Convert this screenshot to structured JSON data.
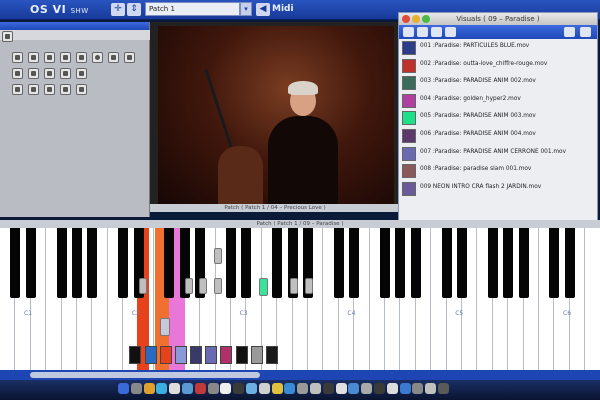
{
  "app": {
    "brand": "OS VI",
    "brand_suffix": "SHW"
  },
  "toolbar": {
    "patch_value": "Patch 1",
    "midi_label": "Midi"
  },
  "visuals_window": {
    "title": "Visuals ( 09 – Paradise )",
    "items": [
      {
        "label": "001 :Paradise: PARTICULES BLUE.mov",
        "thumb_color": "#2a3c8a"
      },
      {
        "label": "002 :Paradise: outta-love_chiffre-rouge.mov",
        "thumb_color": "#c0302a"
      },
      {
        "label": "003 :Paradise: PARADISE ANIM 002.mov",
        "thumb_color": "#3a6a5a"
      },
      {
        "label": "004 :Paradise: golden_hyper2.mov",
        "thumb_color": "#b040a0"
      },
      {
        "label": "005 :Paradise: PARADISE ANIM 003.mov",
        "thumb_color": "#1fe08a"
      },
      {
        "label": "006 :Paradise: PARADISE ANIM 004.mov",
        "thumb_color": "#5a3a6a"
      },
      {
        "label": "007 :Paradise: PARADISE ANIM CERRONE 001.mov",
        "thumb_color": "#6a6ab0"
      },
      {
        "label": "008 :Paradise: paradise slam 001.mov",
        "thumb_color": "#8a5a5a"
      },
      {
        "label": "009 NEON INTRO CRA flash 2 JARDIN.mov",
        "thumb_color": "#6a5a9a"
      }
    ]
  },
  "patch_strip_video": "Patch ( Patch 1 / 04 – Precious Love )",
  "patch_strip_keyboard": "Patch ( Patch 1 / 09 – Paradise )",
  "keyboard": {
    "octave_labels": [
      "C1",
      "C2",
      "C3",
      "C4",
      "C5",
      "C6"
    ]
  }
}
